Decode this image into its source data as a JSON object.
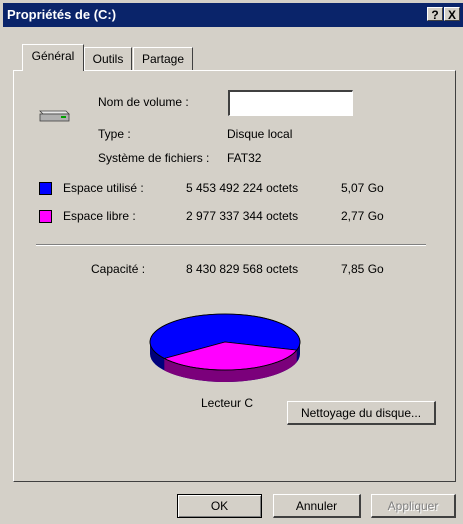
{
  "window": {
    "title": "Propriétés de  (C:)"
  },
  "titlebar_buttons": {
    "help": "?",
    "close": "X"
  },
  "tabs": [
    {
      "label": "Général",
      "active": true
    },
    {
      "label": "Outils",
      "active": false
    },
    {
      "label": "Partage",
      "active": false
    }
  ],
  "general": {
    "volume_name_label": "Nom de volume :",
    "volume_name_value": "",
    "type_label": "Type :",
    "type_value": "Disque local",
    "fs_label": "Système de fichiers :",
    "fs_value": "FAT32",
    "used": {
      "label": "Espace utilisé :",
      "bytes": "5 453 492 224 octets",
      "size": "5,07 Go",
      "color": "#0000ff"
    },
    "free": {
      "label": "Espace libre :",
      "bytes": "2 977 337 344 octets",
      "size": "2,77 Go",
      "color": "#ff00ff"
    },
    "capacity": {
      "label": "Capacité :",
      "bytes": "8 430 829 568 octets",
      "size": "7,85 Go"
    },
    "drive_label": "Lecteur C",
    "cleanup_button": "Nettoyage du disque...",
    "used_fraction": 0.647
  },
  "footer": {
    "ok": "OK",
    "cancel": "Annuler",
    "apply": "Appliquer"
  }
}
